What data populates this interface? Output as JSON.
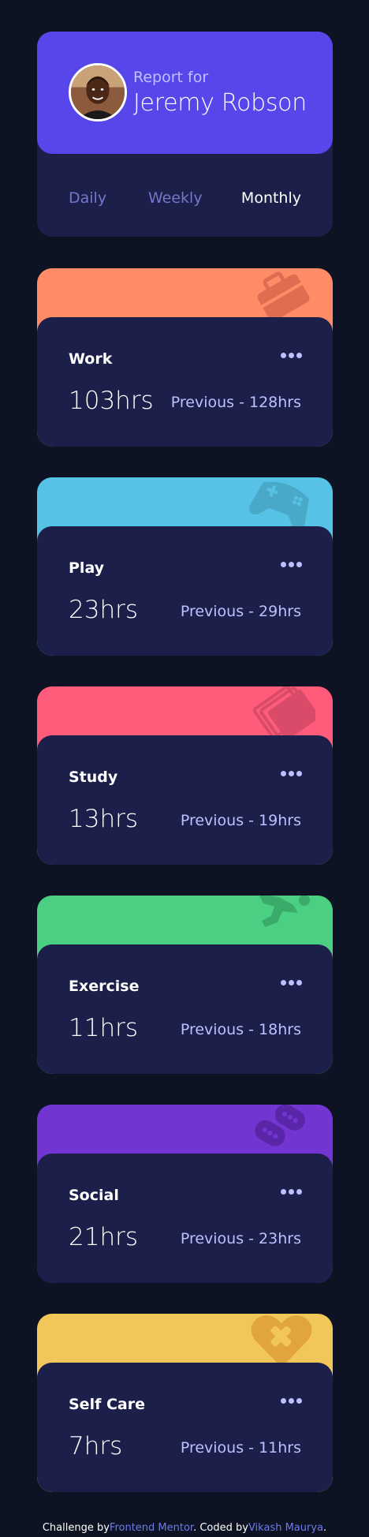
{
  "profile": {
    "report_for": "Report for",
    "name": "Jeremy Robson",
    "avatar_icon": "user-avatar"
  },
  "tabs": [
    {
      "label": "Daily",
      "active": false
    },
    {
      "label": "Weekly",
      "active": false
    },
    {
      "label": "Monthly",
      "active": true
    }
  ],
  "activities": [
    {
      "title": "Work",
      "current": "103hrs",
      "previous": "Previous - 128hrs",
      "color": "#ff8c66",
      "icon": "briefcase-icon"
    },
    {
      "title": "Play",
      "current": "23hrs",
      "previous": "Previous - 29hrs",
      "color": "#56c2e6",
      "icon": "gamepad-icon"
    },
    {
      "title": "Study",
      "current": "13hrs",
      "previous": "Previous - 19hrs",
      "color": "#ff5c7c",
      "icon": "book-icon"
    },
    {
      "title": "Exercise",
      "current": "11hrs",
      "previous": "Previous - 18hrs",
      "color": "#4bcf83",
      "icon": "runner-icon"
    },
    {
      "title": "Social",
      "current": "21hrs",
      "previous": "Previous - 23hrs",
      "color": "#7335d2",
      "icon": "chat-bubbles-icon"
    },
    {
      "title": "Self Care",
      "current": "7hrs",
      "previous": "Previous - 11hrs",
      "color": "#f1c65b",
      "icon": "heart-icon"
    }
  ],
  "footer": {
    "challenge_by": "Challenge by",
    "mentor_link": "Frontend Mentor",
    "coded_by": ". Coded by",
    "author_link": "Vikash Maurya",
    "end": "."
  }
}
